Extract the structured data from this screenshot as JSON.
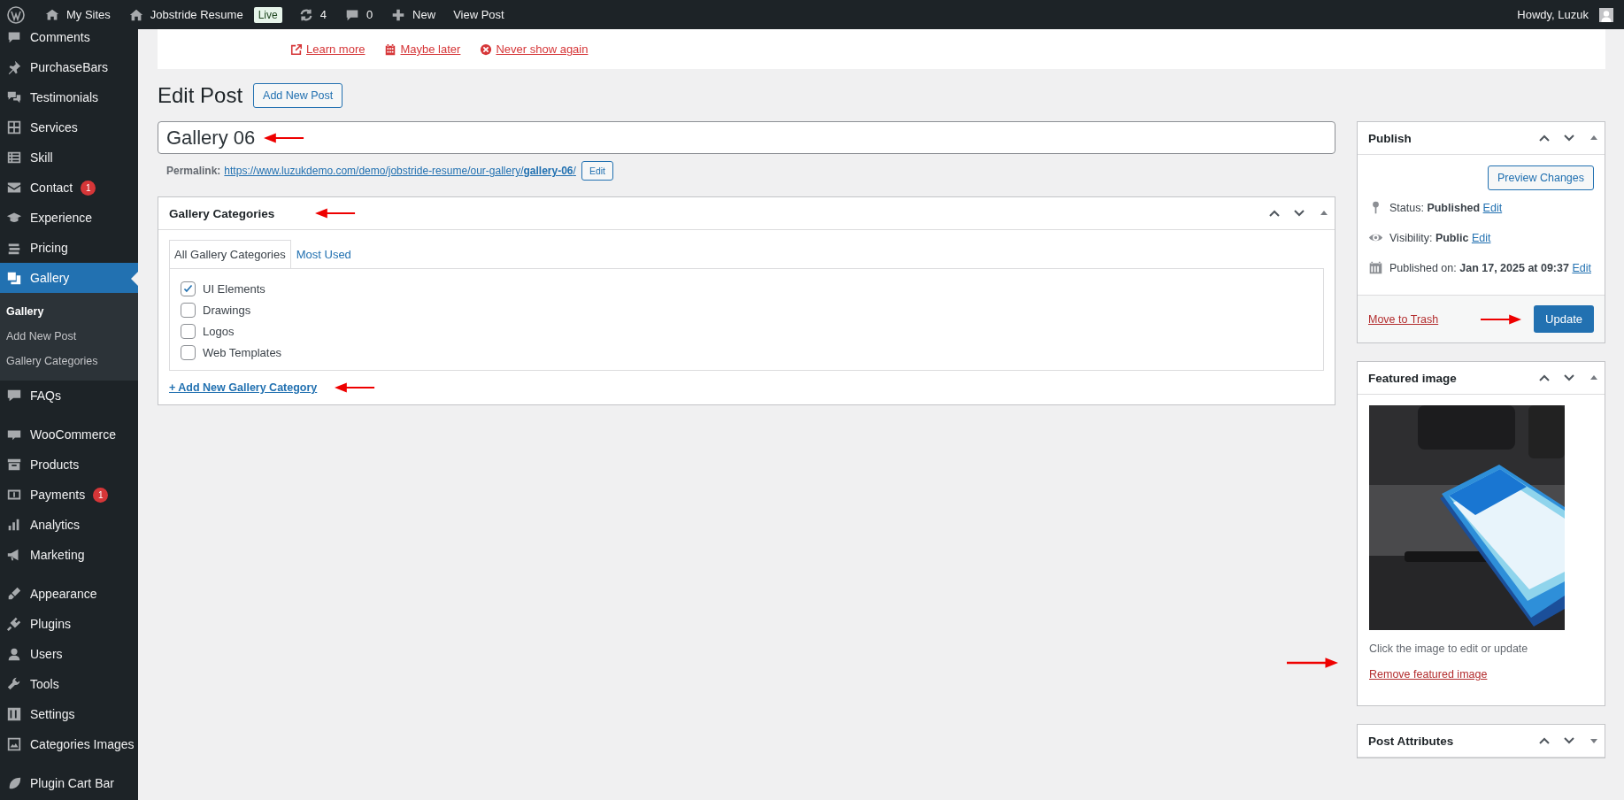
{
  "admin_bar": {
    "items": [
      {
        "kind": "sites",
        "label": "My Sites"
      },
      {
        "kind": "home",
        "label": "Jobstride Resume",
        "badge": "Live"
      },
      {
        "kind": "updates",
        "label": "4"
      },
      {
        "kind": "comments",
        "label": "0"
      },
      {
        "kind": "new",
        "label": "New"
      },
      {
        "kind": "plain",
        "label": "View Post"
      }
    ],
    "greeting": "Howdy, Luzuk"
  },
  "sidebar": {
    "groups": [
      {
        "items": [
          {
            "label": "Comments",
            "selected": false
          },
          {
            "label": "PurchaseBars",
            "selected": false
          },
          {
            "label": "Testimonials",
            "selected": false
          },
          {
            "label": "Services",
            "selected": false
          },
          {
            "label": "Skill",
            "selected": false
          },
          {
            "label": "Contact",
            "badge": "1",
            "selected": false
          },
          {
            "label": "Experience",
            "selected": false
          },
          {
            "label": "Pricing",
            "selected": false
          },
          {
            "label": "Gallery",
            "selected": true,
            "children": [
              {
                "label": "Gallery",
                "selected": true
              },
              {
                "label": "Add New Post",
                "selected": false
              },
              {
                "label": "Gallery Categories",
                "selected": false
              }
            ]
          },
          {
            "label": "FAQs",
            "selected": false
          }
        ]
      },
      {
        "items": [
          {
            "label": "WooCommerce",
            "selected": false
          },
          {
            "label": "Products",
            "selected": false
          },
          {
            "label": "Payments",
            "badge": "1",
            "selected": false
          },
          {
            "label": "Analytics",
            "selected": false
          },
          {
            "label": "Marketing",
            "selected": false
          }
        ]
      },
      {
        "items": [
          {
            "label": "Appearance",
            "selected": false
          },
          {
            "label": "Plugins",
            "selected": false
          },
          {
            "label": "Users",
            "selected": false
          },
          {
            "label": "Tools",
            "selected": false
          },
          {
            "label": "Settings",
            "selected": false
          },
          {
            "label": "Categories Images",
            "selected": false
          }
        ]
      },
      {
        "items": [
          {
            "label": "Plugin Cart Bar",
            "selected": false
          }
        ]
      }
    ]
  },
  "notice": {
    "links": [
      {
        "kind": "external",
        "label": "Learn more"
      },
      {
        "kind": "calendar",
        "label": "Maybe later"
      },
      {
        "kind": "dismiss",
        "label": "Never show again"
      }
    ]
  },
  "heading": "Edit Post",
  "add_new_button": "Add New Post",
  "title_field": {
    "value": "Gallery 06"
  },
  "permalink": {
    "label": "Permalink:",
    "url": "https://www.luzukdemo.com/demo/jobstride-resume/our-gallery/**gallery-06**/",
    "edit_button": "Edit"
  },
  "categories_box": {
    "title": "Gallery Categories",
    "expanded": true,
    "tabs": [
      {
        "label": "All Gallery Categories",
        "selected": true
      },
      {
        "label": "Most Used",
        "selected": false
      }
    ],
    "items": [
      {
        "label": "UI Elements",
        "checked": true
      },
      {
        "label": "Drawings",
        "checked": false
      },
      {
        "label": "Logos",
        "checked": false
      },
      {
        "label": "Web Templates",
        "checked": false
      }
    ],
    "add_link": "+ Add New Gallery Category"
  },
  "publish_box": {
    "title": "Publish",
    "expanded": true,
    "preview_button": "Preview Changes",
    "rows": [
      {
        "kind": "status",
        "text": "Status: **Published**",
        "edit": "Edit"
      },
      {
        "kind": "visibility",
        "text": "Visibility: **Public**",
        "edit": "Edit"
      },
      {
        "kind": "date",
        "text": "Published on: **Jan 17, 2025 at 09:37**",
        "edit": "Edit"
      }
    ],
    "trash_link": "Move to Trash",
    "update_button": "Update"
  },
  "featured_box": {
    "title": "Featured image",
    "expanded": true,
    "caption": "Click the image to edit or update",
    "remove_link": "Remove featured image"
  },
  "attributes_box": {
    "title": "Post Attributes",
    "expanded": false
  }
}
